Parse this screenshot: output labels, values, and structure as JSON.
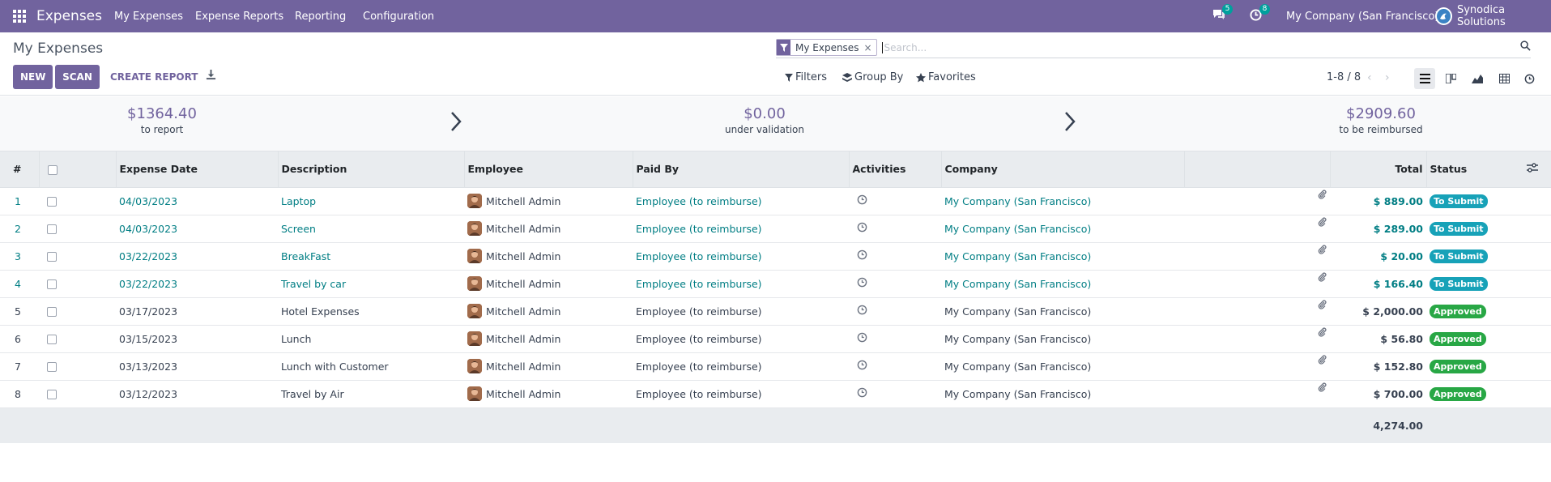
{
  "nav": {
    "brand": "Expenses",
    "items": [
      "My Expenses",
      "Expense Reports",
      "Reporting",
      "Configuration"
    ],
    "messages_count": "5",
    "activities_count": "8",
    "company": "My Company (San Francisco)",
    "user": "Synodica Solutions"
  },
  "control": {
    "title": "My Expenses",
    "new_label": "NEW",
    "scan_label": "SCAN",
    "create_report_label": "CREATE REPORT",
    "facet": "My Expenses",
    "facet_remove": "×",
    "search_placeholder": "Search...",
    "filters_label": "Filters",
    "group_by_label": "Group By",
    "favorites_label": "Favorites",
    "pager": "1-8 / 8",
    "pager_prev": "‹",
    "pager_next": "›"
  },
  "summary": [
    {
      "amount": "$1364.40",
      "label": "to report"
    },
    {
      "amount": "$0.00",
      "label": "under validation"
    },
    {
      "amount": "$2909.60",
      "label": "to be reimbursed"
    }
  ],
  "table": {
    "headers": {
      "num": "#",
      "date": "Expense Date",
      "description": "Description",
      "employee": "Employee",
      "paid_by": "Paid By",
      "activities": "Activities",
      "company": "Company",
      "total": "Total",
      "status": "Status"
    },
    "rows": [
      {
        "n": "1",
        "date": "04/03/2023",
        "desc": "Laptop",
        "employee": "Mitchell Admin",
        "paid_by": "Employee (to reimburse)",
        "company": "My Company (San Francisco)",
        "total": "$ 889.00",
        "status": "To Submit"
      },
      {
        "n": "2",
        "date": "04/03/2023",
        "desc": "Screen",
        "employee": "Mitchell Admin",
        "paid_by": "Employee (to reimburse)",
        "company": "My Company (San Francisco)",
        "total": "$ 289.00",
        "status": "To Submit"
      },
      {
        "n": "3",
        "date": "03/22/2023",
        "desc": "BreakFast",
        "employee": "Mitchell Admin",
        "paid_by": "Employee (to reimburse)",
        "company": "My Company (San Francisco)",
        "total": "$ 20.00",
        "status": "To Submit"
      },
      {
        "n": "4",
        "date": "03/22/2023",
        "desc": "Travel by car",
        "employee": "Mitchell Admin",
        "paid_by": "Employee (to reimburse)",
        "company": "My Company (San Francisco)",
        "total": "$ 166.40",
        "status": "To Submit"
      },
      {
        "n": "5",
        "date": "03/17/2023",
        "desc": "Hotel Expenses",
        "employee": "Mitchell Admin",
        "paid_by": "Employee (to reimburse)",
        "company": "My Company (San Francisco)",
        "total": "$ 2,000.00",
        "status": "Approved"
      },
      {
        "n": "6",
        "date": "03/15/2023",
        "desc": "Lunch",
        "employee": "Mitchell Admin",
        "paid_by": "Employee (to reimburse)",
        "company": "My Company (San Francisco)",
        "total": "$ 56.80",
        "status": "Approved"
      },
      {
        "n": "7",
        "date": "03/13/2023",
        "desc": "Lunch with Customer",
        "employee": "Mitchell Admin",
        "paid_by": "Employee (to reimburse)",
        "company": "My Company (San Francisco)",
        "total": "$ 152.80",
        "status": "Approved"
      },
      {
        "n": "8",
        "date": "03/12/2023",
        "desc": "Travel by Air",
        "employee": "Mitchell Admin",
        "paid_by": "Employee (to reimburse)",
        "company": "My Company (San Francisco)",
        "total": "$ 700.00",
        "status": "Approved"
      }
    ],
    "footer_total": "4,274.00"
  },
  "colors": {
    "brand": "#71639e",
    "link": "#017e84",
    "to_submit": "#17a2b8",
    "approved": "#28a745"
  },
  "icons": [
    "apps-icon",
    "chat-icon",
    "clock-icon",
    "download-icon",
    "filter-icon",
    "search-icon",
    "layers-icon",
    "star-icon",
    "list-view-icon",
    "kanban-view-icon",
    "graph-view-icon",
    "pivot-view-icon",
    "activity-view-icon",
    "chevron-right-icon",
    "paperclip-icon",
    "optional-columns-icon"
  ]
}
